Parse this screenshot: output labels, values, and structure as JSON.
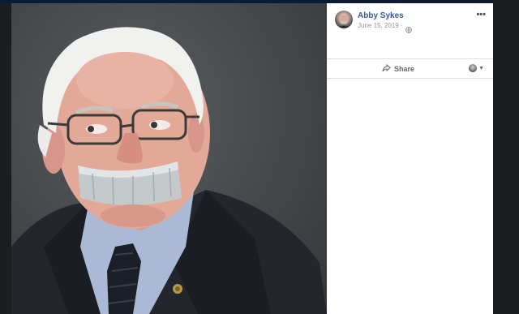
{
  "post": {
    "author": "Abby Sykes",
    "date": "June 15, 2019 ·",
    "more_label": "•••",
    "share_label": "Share"
  },
  "icons": {
    "privacy": "globe-icon",
    "share": "share-arrow-icon",
    "more": "more-options-icon",
    "reactor": "avatar-dropdown"
  },
  "colors": {
    "author_link": "#385898",
    "meta_text": "#90949c",
    "background": "#1c1d20"
  }
}
